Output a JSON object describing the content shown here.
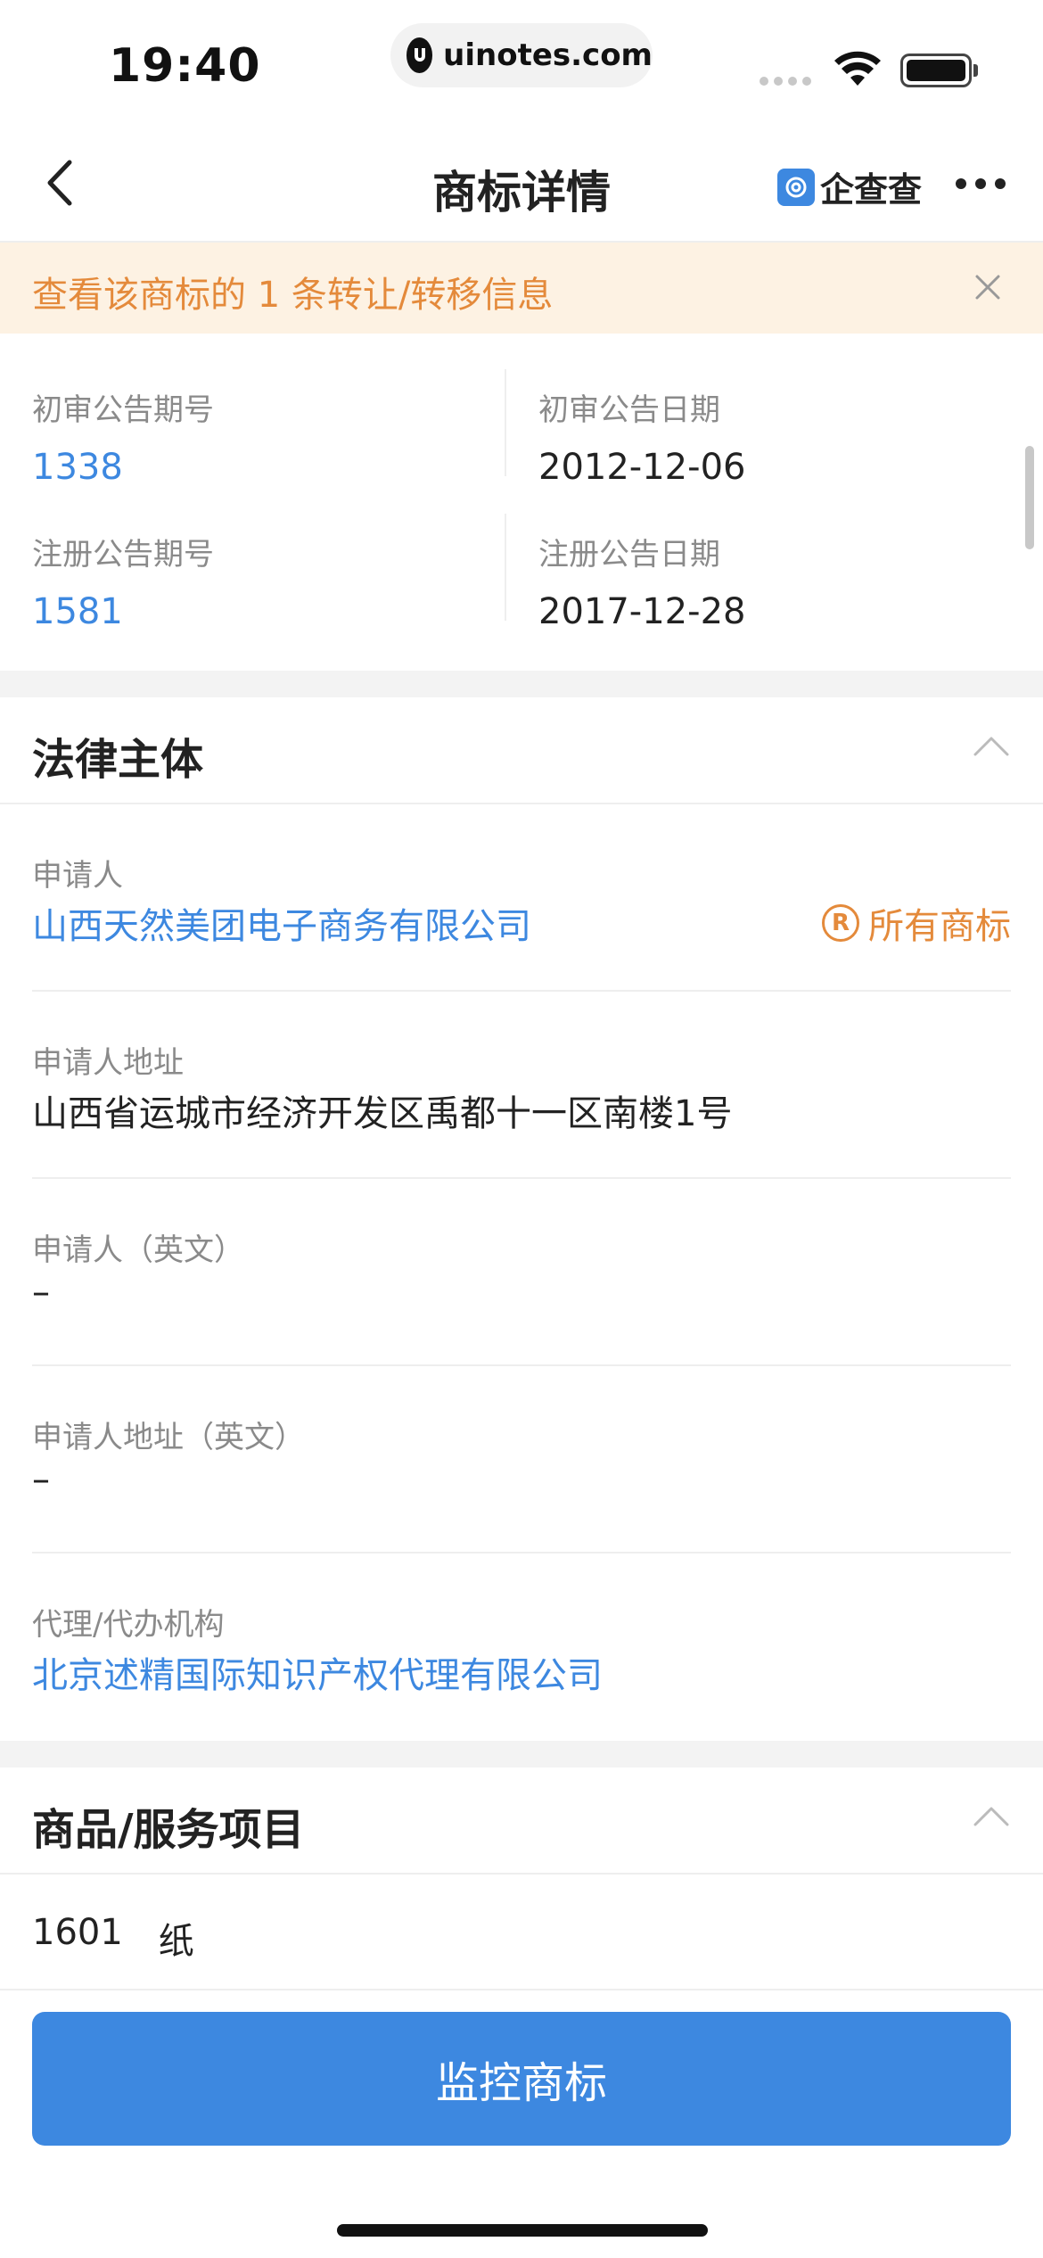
{
  "status_bar": {
    "time": "19:40",
    "url": "uinotes.com"
  },
  "nav": {
    "title": "商标详情",
    "brand": "企查查"
  },
  "notice": {
    "text": "查看该商标的 1 条转让/转移信息"
  },
  "publication": {
    "prelim_issue_label": "初审公告期号",
    "prelim_issue_value": "1338",
    "prelim_date_label": "初审公告日期",
    "prelim_date_value": "2012-12-06",
    "reg_issue_label": "注册公告期号",
    "reg_issue_value": "1581",
    "reg_date_label": "注册公告日期",
    "reg_date_value": "2017-12-28"
  },
  "legal": {
    "title": "法律主体",
    "applicant_label": "申请人",
    "applicant_value": "山西天然美团电子商务有限公司",
    "all_marks_label": "所有商标",
    "address_label": "申请人地址",
    "address_value": "山西省运城市经济开发区禹都十一区南楼1号",
    "applicant_en_label": "申请人（英文）",
    "applicant_en_value": "–",
    "address_en_label": "申请人地址（英文）",
    "address_en_value": "–",
    "agent_label": "代理/代办机构",
    "agent_value": "北京述精国际知识产权代理有限公司"
  },
  "goods": {
    "title": "商品/服务项目",
    "items": [
      {
        "code": "1601",
        "name": "纸"
      }
    ]
  },
  "bottom": {
    "monitor_label": "监控商标"
  },
  "colors": {
    "accent": "#3d88e0",
    "warning": "#e48a3b",
    "notice_bg": "#fdf2e3"
  }
}
